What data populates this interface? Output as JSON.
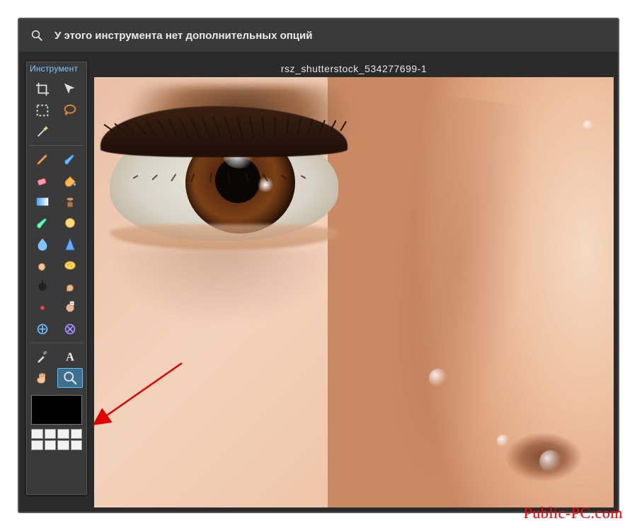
{
  "options_bar": {
    "active_tool_icon": "zoom-icon",
    "message": "У этого инструмента нет дополнительных опций"
  },
  "tools_panel": {
    "title": "Инструмент",
    "tools": [
      {
        "name": "crop-tool",
        "icon": "crop-icon",
        "selected": false
      },
      {
        "name": "move-tool",
        "icon": "move-icon",
        "selected": false
      },
      {
        "name": "marquee-tool",
        "icon": "marquee-icon",
        "selected": false
      },
      {
        "name": "lasso-tool",
        "icon": "lasso-icon",
        "selected": false
      },
      {
        "name": "wand-tool",
        "icon": "wand-icon",
        "selected": false
      },
      {
        "name": "divider"
      },
      {
        "name": "pencil-tool",
        "icon": "pencil-icon",
        "selected": false
      },
      {
        "name": "brush-tool",
        "icon": "brush-icon",
        "selected": false
      },
      {
        "name": "eraser-tool",
        "icon": "eraser-icon",
        "selected": false
      },
      {
        "name": "bucket-tool",
        "icon": "bucket-icon",
        "selected": false
      },
      {
        "name": "gradient-tool",
        "icon": "gradient-icon",
        "selected": false
      },
      {
        "name": "clone-tool",
        "icon": "clone-icon",
        "selected": false
      },
      {
        "name": "colorreplace-tool",
        "icon": "colorreplace-icon",
        "selected": false
      },
      {
        "name": "brush2-tool",
        "icon": "brush2-icon",
        "selected": false
      },
      {
        "name": "blur-tool",
        "icon": "blur-icon",
        "selected": false
      },
      {
        "name": "sharpen-tool",
        "icon": "sharpen-icon",
        "selected": false
      },
      {
        "name": "smudge-tool",
        "icon": "smudge-icon",
        "selected": false
      },
      {
        "name": "sponge-tool",
        "icon": "sponge-icon",
        "selected": false
      },
      {
        "name": "dodge-tool",
        "icon": "dodge-icon",
        "selected": false
      },
      {
        "name": "burn-tool",
        "icon": "burn-icon",
        "selected": false
      },
      {
        "name": "redeye-tool",
        "icon": "redeye-icon",
        "selected": false
      },
      {
        "name": "spotheal-tool",
        "icon": "spotheal-icon",
        "selected": false
      },
      {
        "name": "bloat-tool",
        "icon": "bloat-icon",
        "selected": false
      },
      {
        "name": "pinch-tool",
        "icon": "pinch-icon",
        "selected": false
      },
      {
        "name": "divider"
      },
      {
        "name": "eyedropper-tool",
        "icon": "eyedropper-icon",
        "selected": false
      },
      {
        "name": "type-tool",
        "icon": "type-icon",
        "selected": false
      },
      {
        "name": "hand-tool",
        "icon": "hand-icon",
        "selected": false
      },
      {
        "name": "zoom-tool",
        "icon": "zoom-icon",
        "selected": true
      }
    ],
    "swatch": {
      "foreground": "#000000",
      "background": "#ffffff"
    }
  },
  "canvas": {
    "file_title": "rsz_shutterstock_534277699-1"
  },
  "watermark": "Public-PC.com"
}
